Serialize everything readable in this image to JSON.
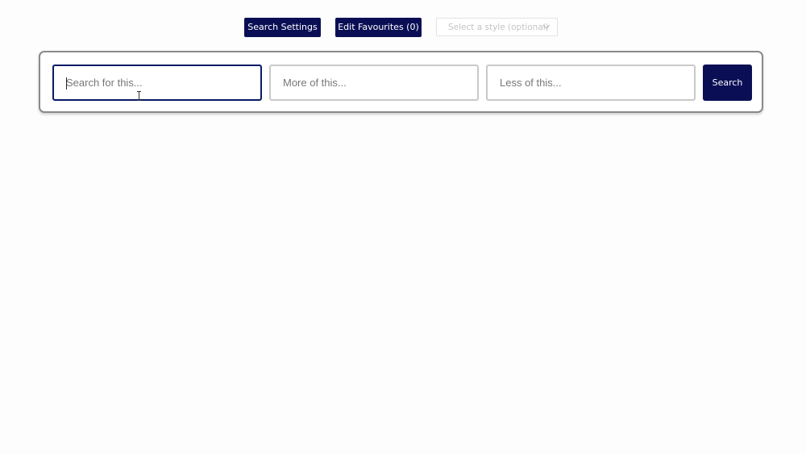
{
  "toolbar": {
    "search_settings_label": "Search Settings",
    "edit_favourites_label": "Edit Favourites (0)",
    "style_select": {
      "placeholder": "Select a style (optional)",
      "icon": "chevron-down-icon"
    }
  },
  "search_panel": {
    "search_field": {
      "value": "",
      "placeholder": "Search for this..."
    },
    "more_field": {
      "value": "",
      "placeholder": "More of this..."
    },
    "less_field": {
      "value": "",
      "placeholder": "Less of this..."
    },
    "search_button_label": "Search"
  },
  "colors": {
    "accent_navy": "#0a0f55",
    "active_border": "#0a1a66",
    "panel_border": "#8a8a8a",
    "input_border": "#c9c9c9"
  }
}
